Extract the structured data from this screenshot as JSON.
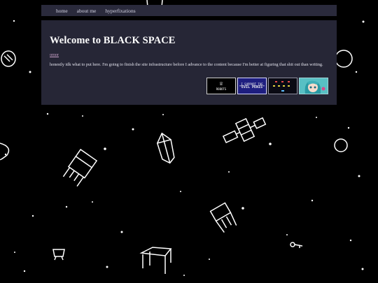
{
  "nav": {
    "home": "home",
    "about": "about me",
    "hyperfixations": "hyperfixations"
  },
  "main": {
    "title": "Welcome to BLACK SPACE",
    "link": "ornor",
    "paragraph": "honestly idk what to put here. I'm going to finish the site infrastructure before I advance to the content because I'm better at figuring that shit out than writing."
  },
  "badges": {
    "robots_label": "ROBOTS",
    "evil_line1": "I SUPPORT THE",
    "evil_line2": "\"EVIL PENIS\""
  },
  "colors": {
    "background": "#000000",
    "panel": "#262636",
    "navbar": "#2a2a3c",
    "link": "#c8a0c8"
  }
}
